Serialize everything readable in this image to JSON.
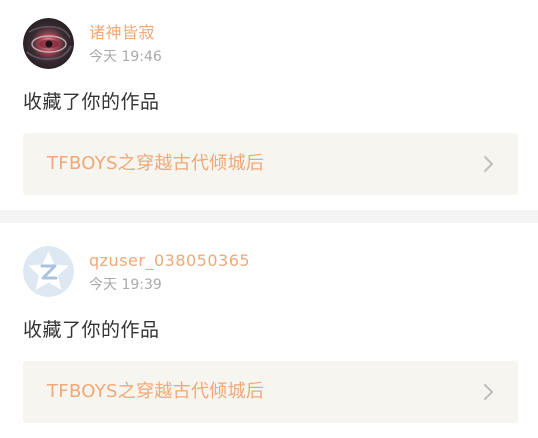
{
  "notifications": [
    {
      "username": "诸神皆寂",
      "timestamp": "今天 19:46",
      "action": "收藏了你的作品",
      "work_title": "TFBOYS之穿越古代倾城后",
      "avatar_icon": "eye-art-avatar-icon"
    },
    {
      "username": "qzuser_038050365",
      "timestamp": "今天 19:39",
      "action": "收藏了你的作品",
      "work_title": "TFBOYS之穿越古代倾城后",
      "avatar_icon": "default-qz-avatar-icon"
    }
  ],
  "colors": {
    "accent": "#f0a878",
    "card_bg": "#f6f5ef",
    "separator": "#f4f4f4",
    "muted": "#aaaaaa",
    "text": "#333333"
  },
  "icons": {
    "chevron": "chevron-right-icon"
  }
}
